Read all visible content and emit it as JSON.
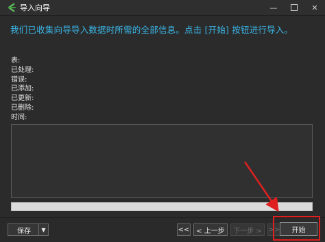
{
  "window": {
    "title": "导入向导",
    "minimize_label": "—",
    "close_label": "✕"
  },
  "info_text": "我们已收集向导导入数据时所需的全部信息。点击 [开始] 按钮进行导入。",
  "stats": [
    {
      "label": "表:"
    },
    {
      "label": "已处理:"
    },
    {
      "label": "错误:"
    },
    {
      "label": "已添加:"
    },
    {
      "label": "已更新:"
    },
    {
      "label": "已删除:"
    },
    {
      "label": "时间:"
    }
  ],
  "log": "",
  "progress": {
    "fraction": 0
  },
  "buttons": {
    "save": "保存",
    "save_dropdown": "▼",
    "first": "<<",
    "prev": "< 上一步",
    "next": "下一步 >",
    "last": ">>",
    "start": "开始"
  },
  "colors": {
    "info_text": "#3ab7e8",
    "annotation": "#e02020",
    "background": "#2b2b2b"
  }
}
